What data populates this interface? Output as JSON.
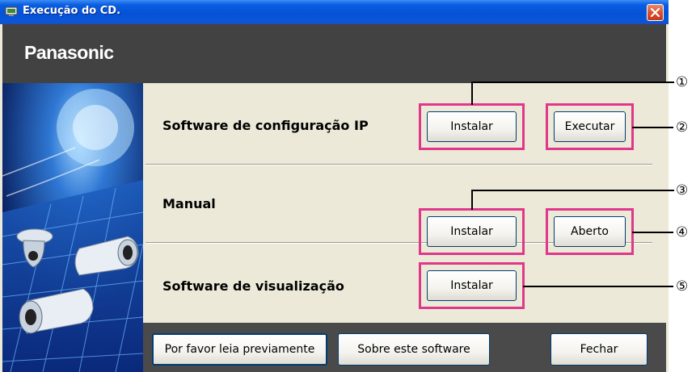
{
  "window": {
    "title": "Execução do CD.",
    "brand": "Panasonic"
  },
  "sections": [
    {
      "label": "Software de configuração IP",
      "buttons": [
        "Instalar",
        "Executar"
      ]
    },
    {
      "label": "Manual",
      "buttons": [
        "Instalar",
        "Aberto"
      ]
    },
    {
      "label": "Software de visualização",
      "buttons": [
        "Instalar"
      ]
    }
  ],
  "footer": {
    "read_first": "Por favor leia previamente",
    "about": "Sobre este software",
    "close": "Fechar"
  },
  "callouts": [
    "①",
    "②",
    "③",
    "④",
    "⑤"
  ],
  "colors": {
    "highlight": "#e0378b",
    "titlebar": "#0552d6",
    "header": "#424242"
  }
}
